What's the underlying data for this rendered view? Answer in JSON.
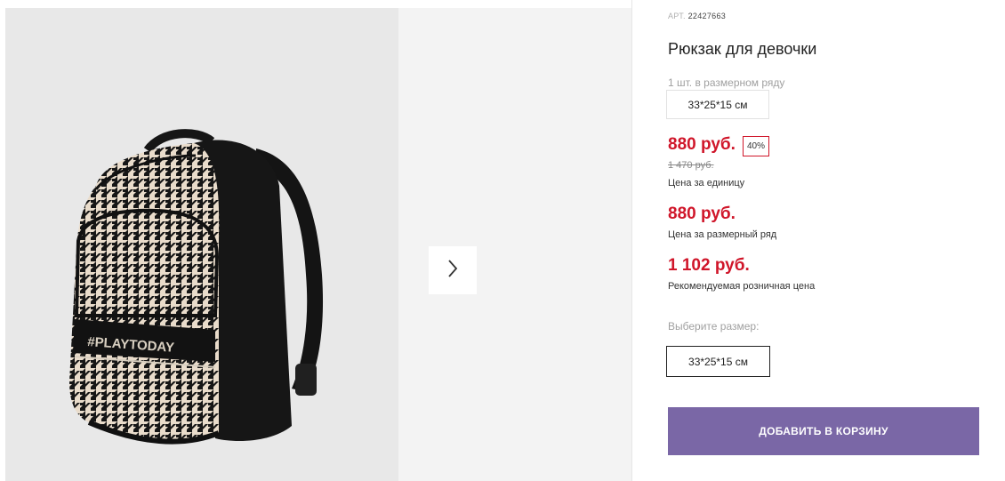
{
  "product": {
    "art_label": "АРТ.",
    "art_number": "22427663",
    "title": "Рюкзак для девочки",
    "pack_note": "1 шт. в размерном ряду",
    "pack_size": "33*25*15 см",
    "image_text": "#PLAYTODAY"
  },
  "pricing": {
    "unit_price": "880 руб.",
    "discount": "40%",
    "old_price": "1 470 руб.",
    "unit_caption": "Цена за единицу",
    "row_price": "880 руб.",
    "row_caption": "Цена за размерный ряд",
    "retail_price": "1 102 руб.",
    "retail_caption": "Рекомендуемая розничная цена"
  },
  "size_select": {
    "label": "Выберите размер:",
    "option": "33*25*15 см"
  },
  "actions": {
    "add_to_cart": "ДОБАВИТЬ В КОРЗИНУ"
  },
  "colors": {
    "price_red": "#d0162a",
    "cart_purple": "#7a67a6"
  }
}
